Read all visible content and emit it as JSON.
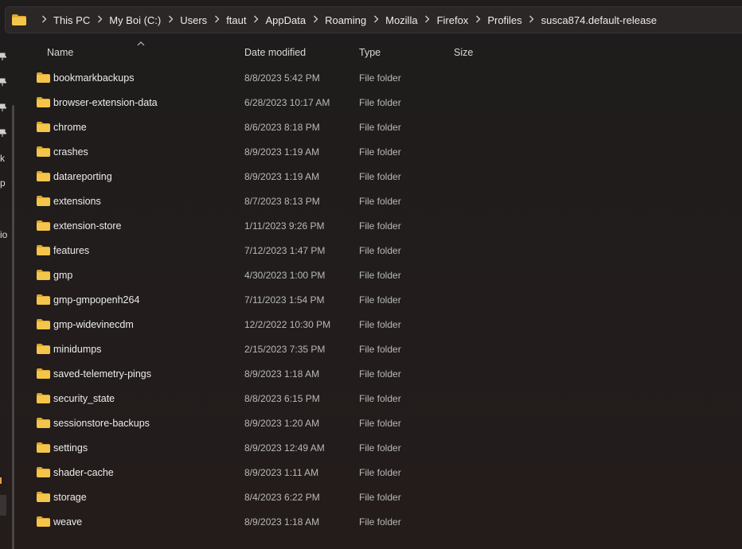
{
  "address_bar": {
    "icon": "folder-icon",
    "crumbs": [
      "This PC",
      "My Boi (C:)",
      "Users",
      "ftaut",
      "AppData",
      "Roaming",
      "Mozilla",
      "Firefox",
      "Profiles",
      "susca874.default-release"
    ],
    "separator_icon": "chevron-right-icon"
  },
  "nav": {
    "fragments": [
      "k",
      "p",
      "io"
    ]
  },
  "columns": {
    "name": "Name",
    "date": "Date modified",
    "type": "Type",
    "size": "Size",
    "sort_icon": "sort-ascending-icon"
  },
  "rows": [
    {
      "name": "bookmarkbackups",
      "date": "8/8/2023 5:42 PM",
      "type": "File folder",
      "size": ""
    },
    {
      "name": "browser-extension-data",
      "date": "6/28/2023 10:17 AM",
      "type": "File folder",
      "size": ""
    },
    {
      "name": "chrome",
      "date": "8/6/2023 8:18 PM",
      "type": "File folder",
      "size": ""
    },
    {
      "name": "crashes",
      "date": "8/9/2023 1:19 AM",
      "type": "File folder",
      "size": ""
    },
    {
      "name": "datareporting",
      "date": "8/9/2023 1:19 AM",
      "type": "File folder",
      "size": ""
    },
    {
      "name": "extensions",
      "date": "8/7/2023 8:13 PM",
      "type": "File folder",
      "size": ""
    },
    {
      "name": "extension-store",
      "date": "1/11/2023 9:26 PM",
      "type": "File folder",
      "size": ""
    },
    {
      "name": "features",
      "date": "7/12/2023 1:47 PM",
      "type": "File folder",
      "size": ""
    },
    {
      "name": "gmp",
      "date": "4/30/2023 1:00 PM",
      "type": "File folder",
      "size": ""
    },
    {
      "name": "gmp-gmpopenh264",
      "date": "7/11/2023 1:54 PM",
      "type": "File folder",
      "size": ""
    },
    {
      "name": "gmp-widevinecdm",
      "date": "12/2/2022 10:30 PM",
      "type": "File folder",
      "size": ""
    },
    {
      "name": "minidumps",
      "date": "2/15/2023 7:35 PM",
      "type": "File folder",
      "size": ""
    },
    {
      "name": "saved-telemetry-pings",
      "date": "8/9/2023 1:18 AM",
      "type": "File folder",
      "size": ""
    },
    {
      "name": "security_state",
      "date": "8/8/2023 6:15 PM",
      "type": "File folder",
      "size": ""
    },
    {
      "name": "sessionstore-backups",
      "date": "8/9/2023 1:20 AM",
      "type": "File folder",
      "size": ""
    },
    {
      "name": "settings",
      "date": "8/9/2023 12:49 AM",
      "type": "File folder",
      "size": ""
    },
    {
      "name": "shader-cache",
      "date": "8/9/2023 1:11 AM",
      "type": "File folder",
      "size": ""
    },
    {
      "name": "storage",
      "date": "8/4/2023 6:22 PM",
      "type": "File folder",
      "size": ""
    },
    {
      "name": "weave",
      "date": "8/9/2023 1:18 AM",
      "type": "File folder",
      "size": ""
    }
  ],
  "colors": {
    "folder": "#f4c54a",
    "folder_dark": "#d9a52c",
    "background": "#1e1c1c"
  }
}
